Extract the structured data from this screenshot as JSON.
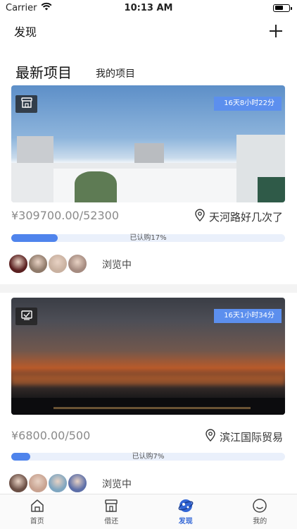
{
  "status_bar": {
    "carrier": "Carrier",
    "time": "10:13 AM"
  },
  "nav": {
    "title": "发现"
  },
  "tabs": {
    "latest": "最新项目",
    "mine": "我的项目"
  },
  "projects": [
    {
      "remaining": "16天8小时22分",
      "price": "¥309700.00/52300",
      "location": "天河路好几次了",
      "progress_percent": 17,
      "progress_text": "已认购17%",
      "viewer_status": "浏览中",
      "avatar_colors": [
        "#5a2020",
        "#8f7a6a",
        "#c9b1a0",
        "#a58b80"
      ]
    },
    {
      "remaining": "16天1小时34分",
      "price": "¥6800.00/500",
      "location": "滨江国际贸易",
      "progress_percent": 7,
      "progress_text": "已认购7%",
      "viewer_status": "浏览中",
      "avatar_colors": [
        "#6b4f45",
        "#c8a290",
        "#7fa6c0",
        "#5d6fa8"
      ]
    }
  ],
  "tab_bar": {
    "items": [
      {
        "label": "首页",
        "icon": "home-icon"
      },
      {
        "label": "借还",
        "icon": "store-icon"
      },
      {
        "label": "发现",
        "icon": "discover-icon"
      },
      {
        "label": "我的",
        "icon": "profile-icon"
      }
    ],
    "active_index": 2
  },
  "colors": {
    "accent": "#3266d6",
    "badge": "#5c8fee",
    "progress": "#4f84ec"
  }
}
